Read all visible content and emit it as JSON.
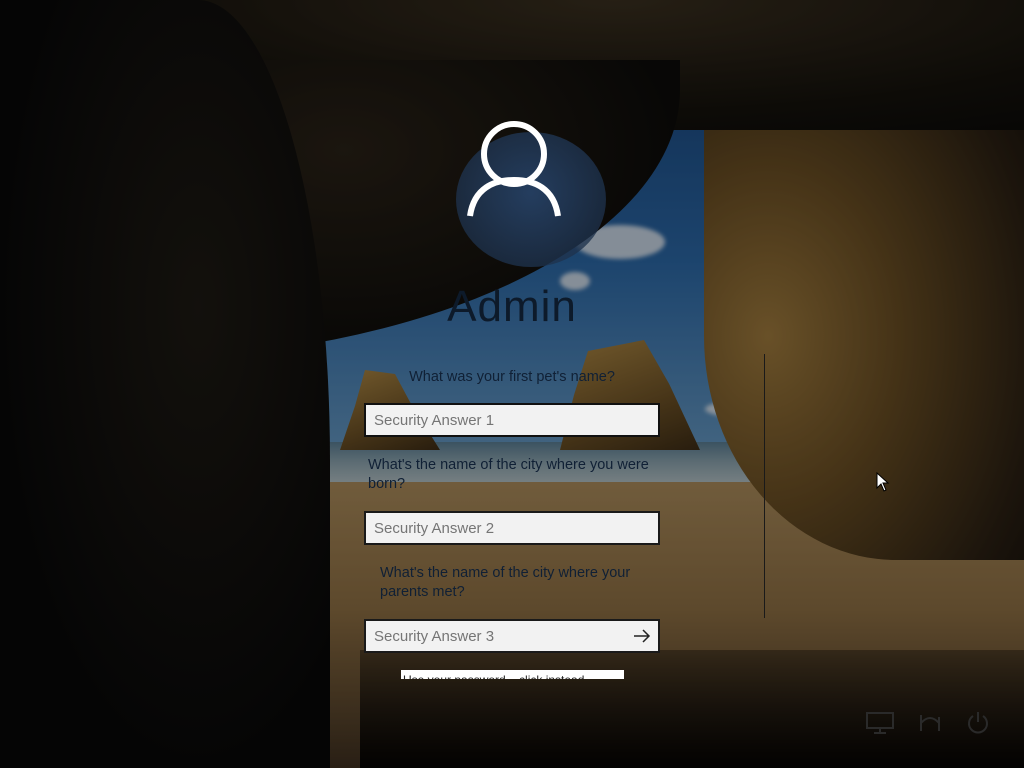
{
  "user": {
    "name": "Admin"
  },
  "security": {
    "question1": "What was your first pet's name?",
    "answer1_placeholder": "Security Answer 1",
    "question2": "What's the name of the city where you were born?",
    "answer2_placeholder": "Security Answer 2",
    "question3": "What's the name of the city where your parents met?",
    "answer3_placeholder": "Security Answer 3",
    "reset_link": "Use your password... click instead"
  },
  "icons": {
    "avatar": "user-icon",
    "submit": "arrow-right-icon",
    "network": "network-icon",
    "accessibility": "ease-of-access-icon",
    "power": "power-icon"
  },
  "colors": {
    "text": "#102035",
    "field_bg": "#f2f2f2",
    "field_border": "#1a1a1a"
  }
}
